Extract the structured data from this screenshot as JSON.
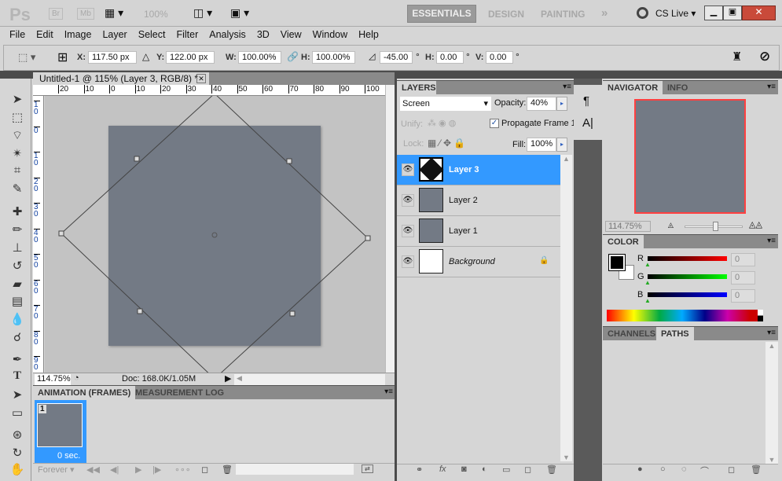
{
  "app": {
    "logo": "Ps",
    "bridge": "Br",
    "minibridge": "Mb",
    "zoom_preset": "100%"
  },
  "workspaces": [
    "ESSENTIALS",
    "DESIGN",
    "PAINTING"
  ],
  "cs_live": "CS Live",
  "menu": [
    "File",
    "Edit",
    "Image",
    "Layer",
    "Select",
    "Filter",
    "Analysis",
    "3D",
    "View",
    "Window",
    "Help"
  ],
  "options": {
    "x_label": "X:",
    "x": "117.50 px",
    "y_label": "Y:",
    "y": "122.00 px",
    "w_label": "W:",
    "w": "100.00%",
    "h_label": "H:",
    "h": "100.00%",
    "angle": "-45.00",
    "deg": "°",
    "hskew_label": "H:",
    "hskew": "0.00",
    "vskew_label": "V:",
    "vskew": "0.00"
  },
  "document": {
    "tab": "Untitled-1 @ 115% (Layer 3, RGB/8) *",
    "zoom": "114.75%",
    "doc_size": "Doc: 168.0K/1.05M",
    "ruler_h": [
      "20",
      "10",
      "0",
      "10",
      "20",
      "30",
      "40",
      "50",
      "60",
      "70",
      "80",
      "90",
      "100"
    ],
    "ruler_v": [
      "10",
      "0",
      "10",
      "20",
      "30",
      "40",
      "50",
      "60",
      "70",
      "80",
      "90"
    ]
  },
  "animation": {
    "tabs": [
      "ANIMATION (FRAMES)",
      "MEASUREMENT LOG"
    ],
    "frame_number": "1",
    "frame_delay": "0 sec.",
    "loop": "Forever"
  },
  "layers": {
    "tab": "LAYERS",
    "blend_mode": "Screen",
    "opacity_label": "Opacity:",
    "opacity": "40%",
    "unify_label": "Unify:",
    "propagate": "Propagate Frame 1",
    "propagate_checked": true,
    "lock_label": "Lock:",
    "fill_label": "Fill:",
    "fill": "100%",
    "items": [
      {
        "name": "Layer 3",
        "selected": true
      },
      {
        "name": "Layer 2"
      },
      {
        "name": "Layer 1"
      },
      {
        "name": "Background",
        "locked": true
      }
    ]
  },
  "navigator": {
    "tabs": [
      "NAVIGATOR",
      "INFO"
    ],
    "zoom": "114.75%",
    "slider_fraction": 0.5
  },
  "color": {
    "tab": "COLOR",
    "r_label": "R",
    "g_label": "G",
    "b_label": "B",
    "r": "0",
    "g": "0",
    "b": "0",
    "foreground": "#000000",
    "background": "#ffffff"
  },
  "paths": {
    "tabs": [
      "CHANNELS",
      "PATHS"
    ]
  },
  "colors": {
    "accent": "#3399ff",
    "canvas": "#737a85",
    "nav_box": "#ff4040"
  }
}
